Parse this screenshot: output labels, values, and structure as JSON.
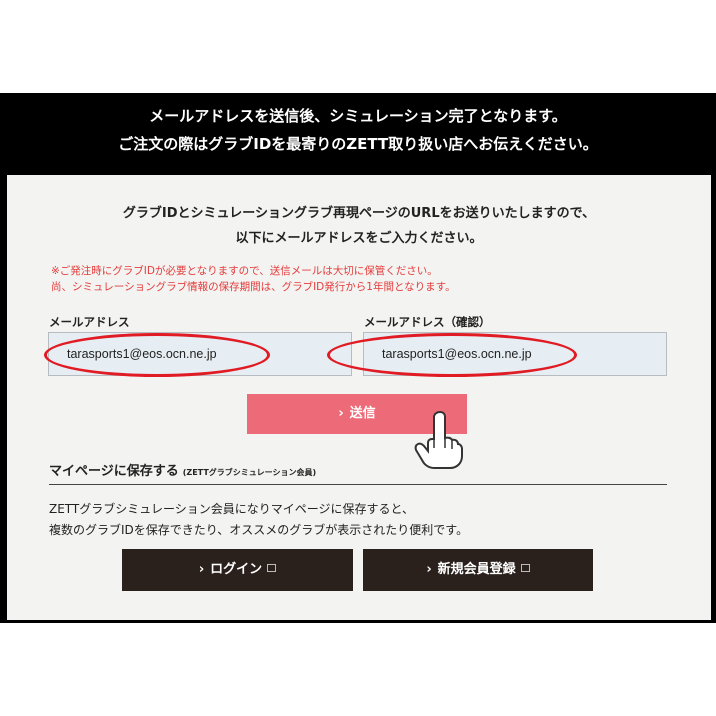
{
  "header": {
    "line1": "メールアドレスを送信後、シミュレーション完了となります。",
    "line2": "ご注文の際はグラブIDを最寄りのZETT取り扱い店へお伝えください。"
  },
  "intro": {
    "line1": "グラブIDとシミュレーショングラブ再現ページのURLをお送りいたしますので、",
    "line2": "以下にメールアドレスをご入力ください。"
  },
  "notice": {
    "line1": "※ご発注時にグラブIDが必要となりますので、送信メールは大切に保管ください。",
    "line2": "尚、シミュレーショングラブ情報の保存期間は、グラブID発行から1年間となります。"
  },
  "form": {
    "email_label": "メールアドレス",
    "email_value": "tarasports1@eos.ocn.ne.jp",
    "confirm_label": "メールアドレス（確認）",
    "confirm_value": "tarasports1@eos.ocn.ne.jp",
    "submit_label": "送信",
    "chevron": "›"
  },
  "mypage": {
    "title": "マイページに保存する",
    "subtitle": "(ZETTグラブシミュレーション会員)",
    "desc1": "ZETTグラブシミュレーション会員になりマイページに保存すると、",
    "desc2": "複数のグラブIDを保存できたり、オススメのグラブが表示されたり便利です。",
    "login_label": "ログイン",
    "register_label": "新規会員登録"
  },
  "colors": {
    "header_bg": "#000000",
    "submit_bg": "#ed6b78",
    "dark_button_bg": "#2a211d",
    "notice_text": "#e43c3c",
    "annotation_ring": "#e01b24"
  },
  "icons": [
    "chevron-right-icon",
    "external-window-icon",
    "pointing-hand-icon"
  ]
}
